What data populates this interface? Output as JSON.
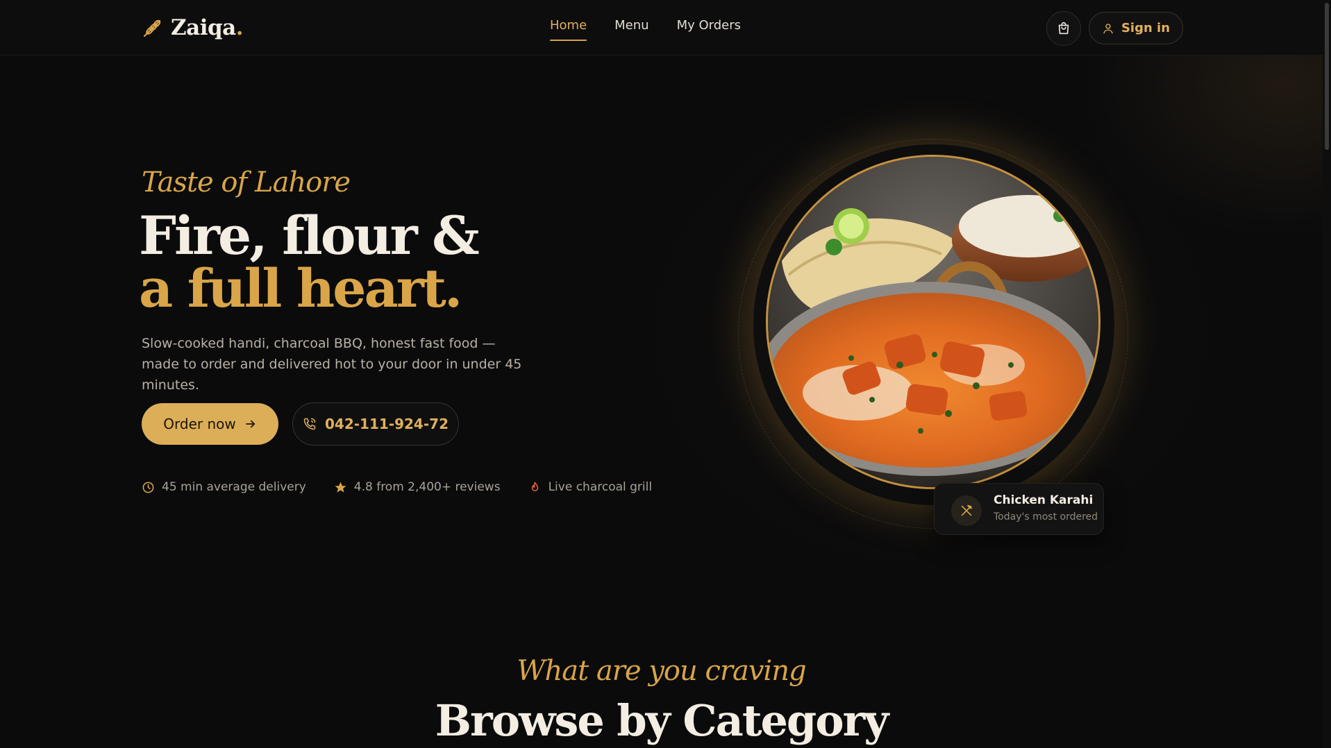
{
  "brand": {
    "name": "Zaiqa",
    "dot": ".",
    "accent": "#d9a548"
  },
  "nav": {
    "items": [
      {
        "label": "Home",
        "active": true
      },
      {
        "label": "Menu",
        "active": false
      },
      {
        "label": "My Orders",
        "active": false
      }
    ]
  },
  "header": {
    "cart_icon": "shopping-bag-icon",
    "signin_label": "Sign in"
  },
  "hero": {
    "eyebrow": "Taste of Lahore",
    "headline_line1": "Fire, flour &",
    "headline_line2": "a full heart.",
    "lead": "Slow-cooked handi, charcoal BBQ, honest fast food — made to order and delivered hot to your door in under 45 minutes.",
    "primary_cta": "Order now",
    "phone_cta": "042-111-924-72",
    "stats": [
      {
        "icon": "clock-icon",
        "text": "45 min average delivery"
      },
      {
        "icon": "star-icon",
        "text": "4.8 from 2,400+ reviews"
      },
      {
        "icon": "flame-icon",
        "text": "Live charcoal grill"
      }
    ],
    "featured": {
      "name": "Chicken Karahi",
      "subtitle": "Today's most ordered",
      "icon": "utensils-icon"
    }
  },
  "categories": {
    "eyebrow": "What are you craving",
    "title": "Browse by Category"
  }
}
